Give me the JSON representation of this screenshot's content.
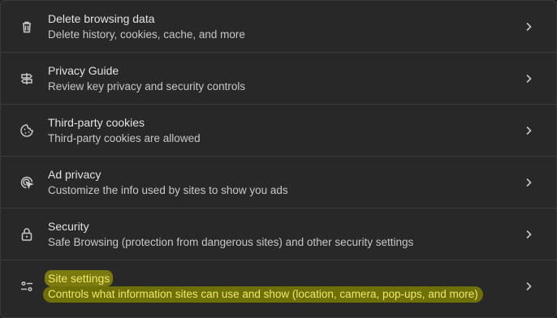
{
  "rows": [
    {
      "icon": "trash-icon",
      "title": "Delete browsing data",
      "subtitle": "Delete history, cookies, cache, and more"
    },
    {
      "icon": "privacy-guide-icon",
      "title": "Privacy Guide",
      "subtitle": "Review key privacy and security controls"
    },
    {
      "icon": "cookie-icon",
      "title": "Third-party cookies",
      "subtitle": "Third-party cookies are allowed"
    },
    {
      "icon": "ad-privacy-icon",
      "title": "Ad privacy",
      "subtitle": "Customize the info used by sites to show you ads"
    },
    {
      "icon": "lock-icon",
      "title": "Security",
      "subtitle": "Safe Browsing (protection from dangerous sites) and other security settings"
    },
    {
      "icon": "site-settings-icon",
      "title": "Site settings",
      "subtitle": "Controls what information sites can use and show (location, camera, pop-ups, and more)",
      "highlight_color": "#f0e86a"
    }
  ]
}
